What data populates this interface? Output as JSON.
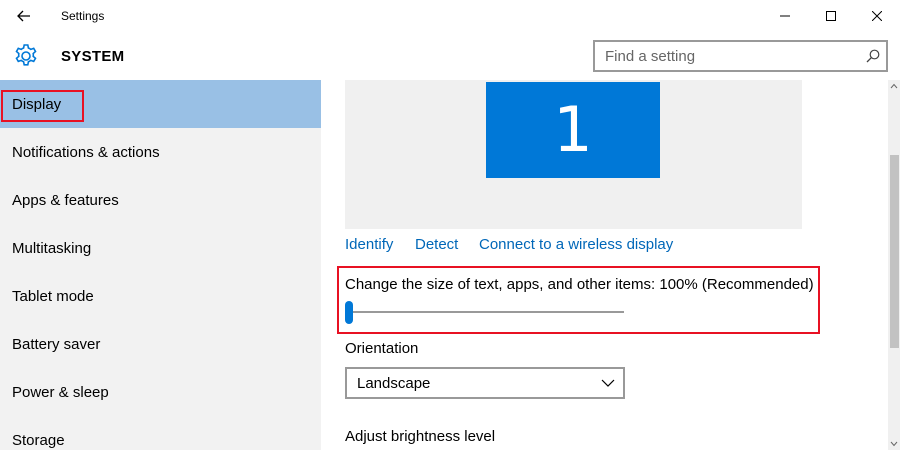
{
  "window": {
    "title": "Settings"
  },
  "header": {
    "title": "SYSTEM",
    "search_placeholder": "Find a setting"
  },
  "sidebar": {
    "items": [
      {
        "label": "Display",
        "selected": true
      },
      {
        "label": "Notifications & actions"
      },
      {
        "label": "Apps & features"
      },
      {
        "label": "Multitasking"
      },
      {
        "label": "Tablet mode"
      },
      {
        "label": "Battery saver"
      },
      {
        "label": "Power & sleep"
      },
      {
        "label": "Storage"
      }
    ]
  },
  "display": {
    "monitor_number": "1",
    "links": {
      "identify": "Identify",
      "detect": "Detect",
      "wireless": "Connect to a wireless display"
    },
    "scale_label": "Change the size of text, apps, and other items: 100% (Recommended)",
    "scale_slider_fraction": 0,
    "orientation_label": "Orientation",
    "orientation_value": "Landscape",
    "brightness_label": "Adjust brightness level"
  },
  "colors": {
    "accent": "#0078d7",
    "link": "#0067b8",
    "selected_nav": "#99c0e5",
    "highlight_border": "#e81123"
  },
  "icons": {
    "back": "back-arrow-icon",
    "settings": "gear-icon",
    "search": "search-icon",
    "minimize": "minimize-icon",
    "maximize": "maximize-icon",
    "close": "close-icon",
    "dropdown": "chevron-down-icon"
  }
}
